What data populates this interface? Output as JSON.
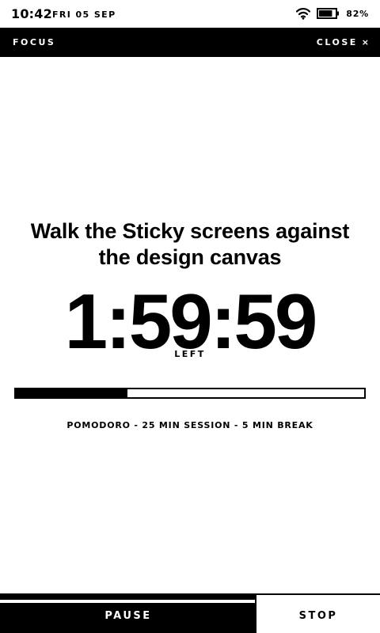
{
  "status_bar": {
    "time": "10:42",
    "date": "FRI 05 SEP",
    "wifi_icon": "wifi-icon",
    "battery_icon": "battery-icon",
    "battery": "82%",
    "battery_level": 0.82
  },
  "header": {
    "title": "FOCUS",
    "close_label": "CLOSE",
    "close_icon": "×"
  },
  "focus": {
    "task": "Walk the Sticky screens against the design canvas",
    "time_left": "1:59:59",
    "time_left_label": "LEFT",
    "progress": 0.32,
    "mode": "POMODORO - 25 MIN SESSION - 5 MIN BREAK"
  },
  "actions": {
    "pause_label": "PAUSE",
    "stop_label": "STOP"
  },
  "colors": {
    "background": "#ffffff",
    "foreground": "#000000"
  }
}
